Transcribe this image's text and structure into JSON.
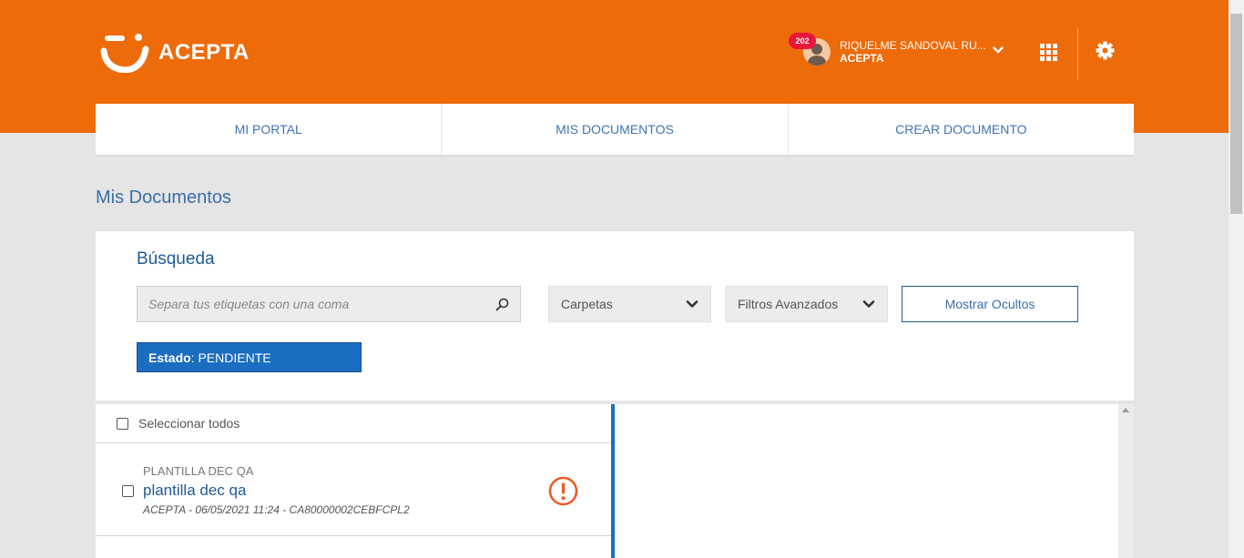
{
  "header": {
    "brand": "ACEPTA",
    "notifications_count": "202",
    "user_name": "RIQUELME SANDOVAL RU...",
    "user_org": "ACEPTA",
    "colors": {
      "brand_orange": "#ee6b0a",
      "accent_blue": "#1b6dc1",
      "badge_red": "#e8173a"
    },
    "icons": [
      "acepta-logo-icon",
      "user-avatar-icon",
      "chevron-down-icon",
      "apps-grid-icon",
      "gear-icon"
    ]
  },
  "nav": {
    "tabs": [
      {
        "label": "MI PORTAL"
      },
      {
        "label": "MIS DOCUMENTOS"
      },
      {
        "label": "CREAR DOCUMENTO"
      }
    ]
  },
  "page": {
    "title": "Mis Documentos"
  },
  "search": {
    "title": "Búsqueda",
    "tags_placeholder": "Separa tus etiquetas con una coma",
    "folders_select": "Carpetas",
    "advanced_select": "Filtros Avanzados",
    "show_hidden_button": "Mostrar Ocultos",
    "active_filter": {
      "key": "Estado",
      "value": ": PENDIENTE"
    }
  },
  "list": {
    "select_all_label": "Seleccionar todos",
    "items": [
      {
        "template": "PLANTILLA DEC QA",
        "title": "plantilla dec qa",
        "meta": "ACEPTA - 06/05/2021 11:24 - CA80000002CEBFCPL2",
        "status_icon": "alert-circle-icon"
      }
    ]
  }
}
